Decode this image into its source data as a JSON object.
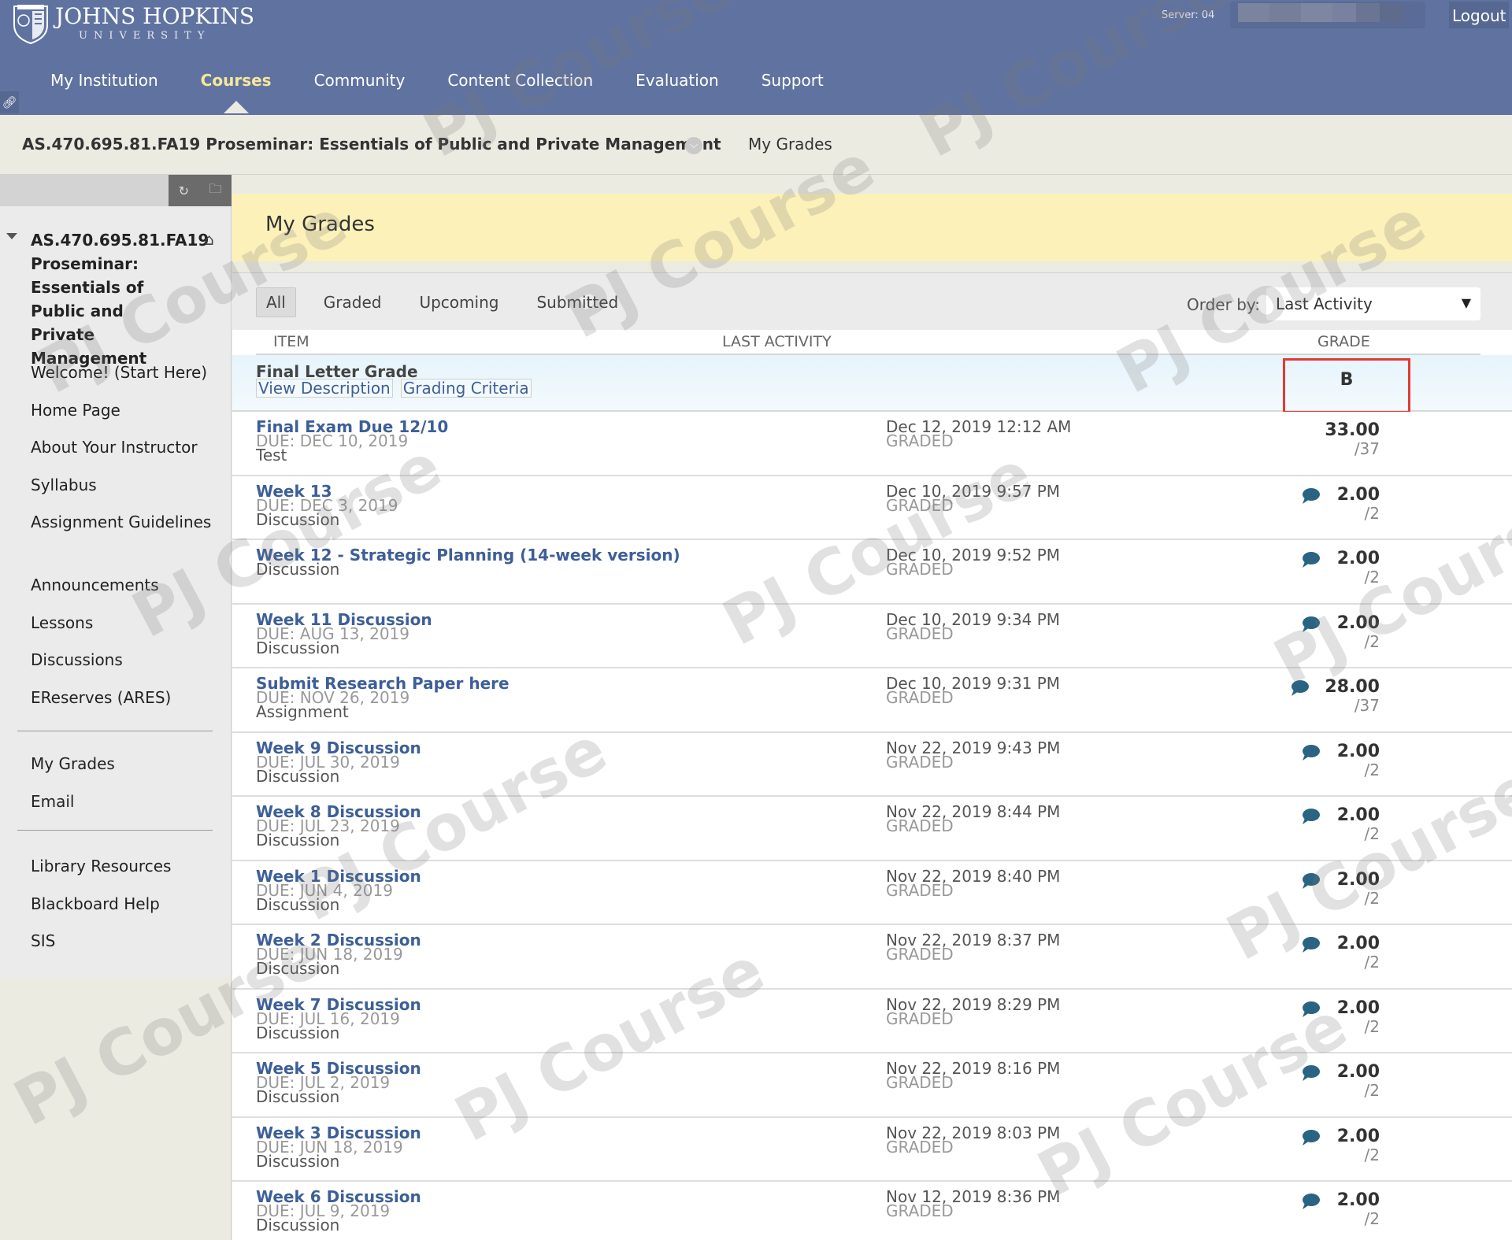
{
  "header": {
    "logo_main": "JOHNS HOPKINS",
    "logo_sub": "UNIVERSITY",
    "server": "Server: 04",
    "logout": "Logout",
    "nav": [
      {
        "label": "My Institution",
        "active": false
      },
      {
        "label": "Courses",
        "active": true
      },
      {
        "label": "Community",
        "active": false
      },
      {
        "label": "Content Collection",
        "active": false
      },
      {
        "label": "Evaluation",
        "active": false
      },
      {
        "label": "Support",
        "active": false
      }
    ]
  },
  "coursebar": {
    "course_title": "AS.470.695.81.FA19 Proseminar: Essentials of Public and Private Management",
    "breadcrumb": "My Grades"
  },
  "sidebar": {
    "course_title": "AS.470.695.81.FA19 Proseminar: Essentials of Public and Private Management",
    "group1": [
      "Welcome! (Start Here)",
      "Home Page",
      "About Your Instructor",
      "Syllabus",
      "Assignment Guidelines"
    ],
    "group2": [
      "Announcements",
      "Lessons",
      "Discussions",
      "EReserves (ARES)"
    ],
    "group3": [
      "My Grades",
      "Email"
    ],
    "group4": [
      "Library Resources",
      "Blackboard Help",
      "SIS"
    ]
  },
  "main": {
    "page_title": "My Grades",
    "filters": [
      {
        "label": "All",
        "active": true
      },
      {
        "label": "Graded",
        "active": false
      },
      {
        "label": "Upcoming",
        "active": false
      },
      {
        "label": "Submitted",
        "active": false
      }
    ],
    "order_by_label": "Order by:",
    "order_by_value": "Last Activity",
    "columns": {
      "item": "ITEM",
      "last_activity": "LAST ACTIVITY",
      "grade": "GRADE"
    },
    "final_grade": {
      "name": "Final Letter Grade",
      "links": [
        "View Description",
        "Grading Criteria"
      ],
      "grade": "B"
    },
    "rows": [
      {
        "name": "Final Exam Due 12/10",
        "due": "DUE: DEC 10, 2019",
        "type": "Test",
        "date": "Dec 12, 2019 12:12 AM",
        "status": "GRADED",
        "grade": "33.00",
        "max": "/37",
        "comment": false
      },
      {
        "name": "Week 13",
        "due": "DUE: DEC 3, 2019",
        "type": "Discussion",
        "date": "Dec 10, 2019 9:57 PM",
        "status": "GRADED",
        "grade": "2.00",
        "max": "/2",
        "comment": true
      },
      {
        "name": "Week 12 - Strategic Planning (14-week version)",
        "due": "",
        "type": "Discussion",
        "date": "Dec 10, 2019 9:52 PM",
        "status": "GRADED",
        "grade": "2.00",
        "max": "/2",
        "comment": true
      },
      {
        "name": "Week 11 Discussion",
        "due": "DUE: AUG 13, 2019",
        "type": "Discussion",
        "date": "Dec 10, 2019 9:34 PM",
        "status": "GRADED",
        "grade": "2.00",
        "max": "/2",
        "comment": true
      },
      {
        "name": "Submit Research Paper here",
        "due": "DUE: NOV 26, 2019",
        "type": "Assignment",
        "date": "Dec 10, 2019 9:31 PM",
        "status": "GRADED",
        "grade": "28.00",
        "max": "/37",
        "comment": true
      },
      {
        "name": "Week 9 Discussion",
        "due": "DUE: JUL 30, 2019",
        "type": "Discussion",
        "date": "Nov 22, 2019 9:43 PM",
        "status": "GRADED",
        "grade": "2.00",
        "max": "/2",
        "comment": true
      },
      {
        "name": "Week 8 Discussion",
        "due": "DUE: JUL 23, 2019",
        "type": "Discussion",
        "date": "Nov 22, 2019 8:44 PM",
        "status": "GRADED",
        "grade": "2.00",
        "max": "/2",
        "comment": true
      },
      {
        "name": "Week 1 Discussion",
        "due": "DUE: JUN 4, 2019",
        "type": "Discussion",
        "date": "Nov 22, 2019 8:40 PM",
        "status": "GRADED",
        "grade": "2.00",
        "max": "/2",
        "comment": true
      },
      {
        "name": "Week 2 Discussion",
        "due": "DUE: JUN 18, 2019",
        "type": "Discussion",
        "date": "Nov 22, 2019 8:37 PM",
        "status": "GRADED",
        "grade": "2.00",
        "max": "/2",
        "comment": true
      },
      {
        "name": "Week 7 Discussion",
        "due": "DUE: JUL 16, 2019",
        "type": "Discussion",
        "date": "Nov 22, 2019 8:29 PM",
        "status": "GRADED",
        "grade": "2.00",
        "max": "/2",
        "comment": true
      },
      {
        "name": "Week 5 Discussion",
        "due": "DUE: JUL 2, 2019",
        "type": "Discussion",
        "date": "Nov 22, 2019 8:16 PM",
        "status": "GRADED",
        "grade": "2.00",
        "max": "/2",
        "comment": true
      },
      {
        "name": "Week 3 Discussion",
        "due": "DUE: JUN 18, 2019",
        "type": "Discussion",
        "date": "Nov 22, 2019 8:03 PM",
        "status": "GRADED",
        "grade": "2.00",
        "max": "/2",
        "comment": true
      },
      {
        "name": "Week 6 Discussion",
        "due": "DUE: JUL 9, 2019",
        "type": "Discussion",
        "date": "Nov 12, 2019 8:36 PM",
        "status": "GRADED",
        "grade": "2.00",
        "max": "/2",
        "comment": true
      }
    ]
  },
  "watermark": "PJ Course",
  "colors": {
    "header_bg": "#6073a0",
    "active_nav": "#f6e79c",
    "link": "#3d5f98",
    "title_band": "#fdf1ba",
    "highlight_border": "#e53935",
    "comment_icon": "#2a6482"
  }
}
